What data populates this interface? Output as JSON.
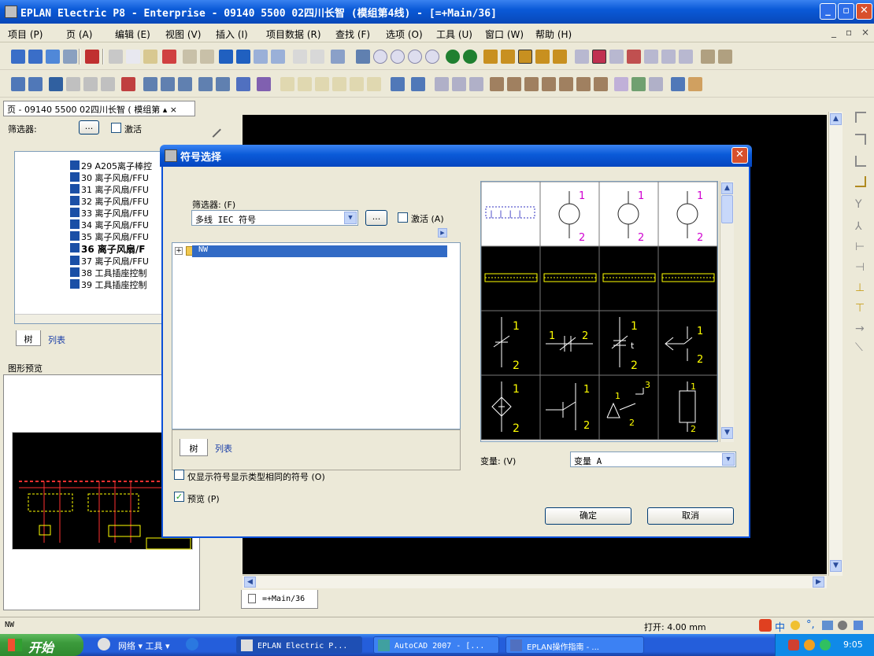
{
  "window": {
    "title": "EPLAN Electric P8 - Enterprise - 09140 5500 02四川长智 (模组第4线) - [=+Main/36]"
  },
  "menu": [
    "项目 (P)",
    "页 (A)",
    "编辑 (E)",
    "视图 (V)",
    "插入 (I)",
    "项目数据 (R)",
    "查找 (F)",
    "选项 (O)",
    "工具 (U)",
    "窗口 (W)",
    "帮助 (H)"
  ],
  "left_panel": {
    "tab_title": "页 - 09140 5500 02四川长智 ( 模组第 ▴ ×",
    "filter_label": "筛选器:",
    "filter_button": "...",
    "activate_label": "激活",
    "tree_items": [
      "29 A205离子棒控",
      "30 离子风扇/FFU",
      "31 离子风扇/FFU",
      "32 离子风扇/FFU",
      "33 离子风扇/FFU",
      "34 离子风扇/FFU",
      "35 离子风扇/FFU",
      "36 离子风扇/F",
      "37 离子风扇/FFU",
      "38 工具插座控制",
      "39 工具插座控制"
    ],
    "tabs": [
      "树",
      "列表"
    ],
    "preview_title": "图形预览"
  },
  "dialog": {
    "title": "符号选择",
    "filter_label": "筛选器: (F)",
    "filter_value": "多线 IEC 符号",
    "filter_button": "...",
    "activate_label": "激活 (A)",
    "tree_root": "NW",
    "tabs": [
      "树",
      "列表"
    ],
    "only_same_type_label": "仅显示符号显示类型相同的符号 (O)",
    "preview_label": "预览 (P)",
    "variant_label": "变量: (V)",
    "variant_value": "变量 A",
    "ok": "确定",
    "cancel": "取消"
  },
  "page_tab": "=+Main/36",
  "status": {
    "left": "NW",
    "open": "打开: 4.00 mm"
  },
  "taskbar": {
    "start": "开始",
    "quick": "网络 ▾ 工具 ▾",
    "tasks": [
      "EPLAN Electric P...",
      "AutoCAD 2007 - [...",
      "EPLAN操作指南 - ..."
    ],
    "clock": "9:05"
  },
  "colors": {
    "titlebar": "#0a5ad8",
    "symbol_stroke": "#ffff00",
    "symbol_label": "#d000d0"
  }
}
